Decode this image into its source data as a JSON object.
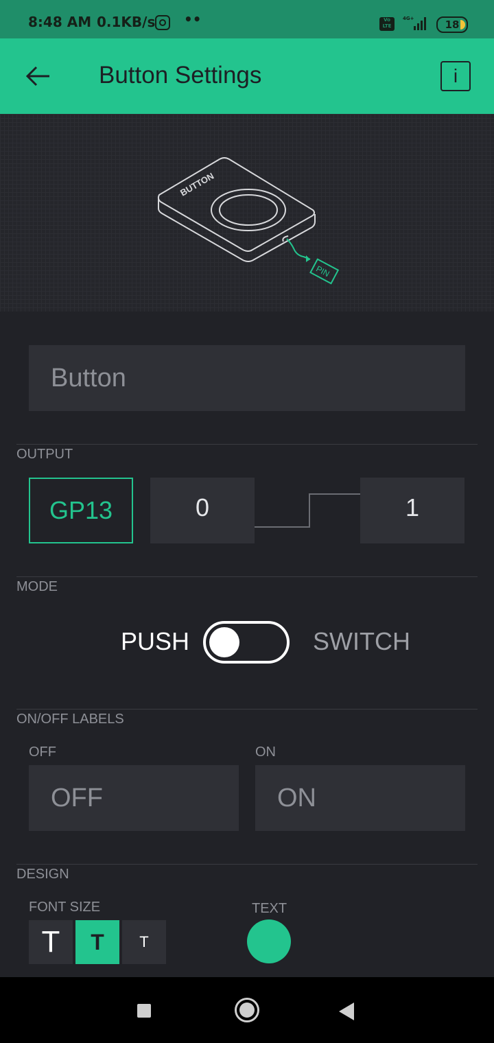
{
  "status_bar": {
    "time": "8:48 AM",
    "network_speed": "0.1KB/s",
    "dots": "••",
    "volte": "Vo LTE",
    "network_type": "4G+",
    "battery": "18"
  },
  "app_bar": {
    "title": "Button Settings",
    "back_icon": "arrow-left-icon",
    "info_label": "i"
  },
  "preview": {
    "device_label": "BUTTON",
    "pin_label": "PIN"
  },
  "name_field": {
    "value": "Button"
  },
  "output": {
    "section_label": "OUTPUT",
    "pin": "GP13",
    "low_value": "0",
    "high_value": "1"
  },
  "mode": {
    "section_label": "MODE",
    "push_label": "PUSH",
    "switch_label": "SWITCH",
    "selected": "PUSH"
  },
  "labels": {
    "section_label": "ON/OFF LABELS",
    "off_caption": "OFF",
    "off_value": "OFF",
    "on_caption": "ON",
    "on_value": "ON"
  },
  "design": {
    "section_label": "DESIGN",
    "font_size_label": "FONT SIZE",
    "font_sizes": [
      "T",
      "T",
      "T"
    ],
    "selected_font_size_index": 1,
    "text_color_label": "TEXT",
    "text_color": "#23c48e"
  },
  "colors": {
    "accent": "#23c48e",
    "status_bar": "#1f8e69",
    "background": "#212227",
    "field": "#2f3036"
  }
}
